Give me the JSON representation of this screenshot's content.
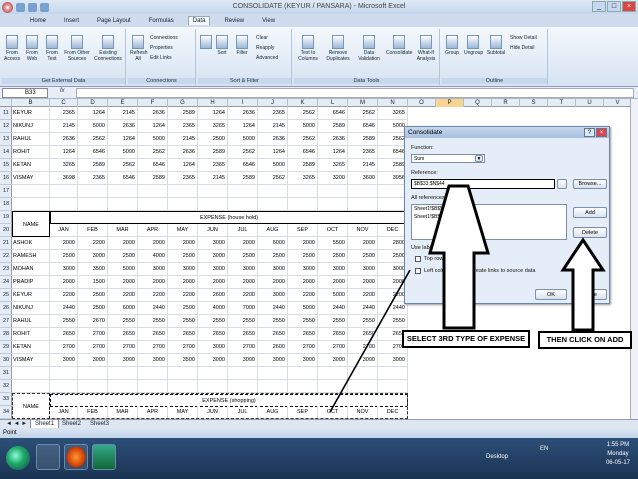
{
  "window": {
    "title": "CONSOLIDATE (KEYUR / PANSARA) - Microsoft Excel"
  },
  "ribbon_tabs": [
    "Home",
    "Insert",
    "Page Layout",
    "Formulas",
    "Data",
    "Review",
    "View"
  ],
  "active_tab": "Data",
  "ribbon": {
    "get_external": {
      "label": "Get External Data",
      "buttons": [
        "From Access",
        "From Web",
        "From Text",
        "From Other Sources",
        "Existing Connections"
      ]
    },
    "connections": {
      "label": "Connections",
      "refresh": "Refresh All",
      "items": [
        "Connections",
        "Properties",
        "Edit Links"
      ]
    },
    "sort_filter": {
      "label": "Sort & Filter",
      "sort": "Sort",
      "filter": "Filter",
      "items": [
        "Clear",
        "Reapply",
        "Advanced"
      ]
    },
    "data_tools": {
      "label": "Data Tools",
      "buttons": [
        "Text to Columns",
        "Remove Duplicates",
        "Data Validation",
        "Consolidate",
        "What-If Analysis"
      ]
    },
    "outline": {
      "label": "Outline",
      "buttons": [
        "Group",
        "Ungroup",
        "Subtotal"
      ],
      "items": [
        "Show Detail",
        "Hide Detail"
      ]
    }
  },
  "formula_bar": {
    "name_box": "B33",
    "fx": "fx",
    "value": ""
  },
  "columns": [
    "B",
    "C",
    "D",
    "E",
    "F",
    "G",
    "H",
    "I",
    "J",
    "K",
    "L",
    "M",
    "N",
    "O",
    "P",
    "Q",
    "R",
    "S",
    "T",
    "U",
    "V"
  ],
  "selected_column": "P",
  "rows_top": [
    {
      "r": "11",
      "name": "KEYUR",
      "v": [
        "2365",
        "1264",
        "2145",
        "2636",
        "2589",
        "1264",
        "2636",
        "2365",
        "2562",
        "6546",
        "2562",
        "3265"
      ]
    },
    {
      "r": "12",
      "name": "NIKUNJ",
      "v": [
        "2145",
        "5000",
        "2636",
        "1264",
        "2365",
        "3265",
        "1264",
        "2145",
        "5000",
        "2589",
        "6546",
        "5000"
      ]
    },
    {
      "r": "13",
      "name": "RAHUL",
      "v": [
        "2636",
        "2562",
        "1264",
        "5000",
        "2145",
        "2500",
        "5000",
        "2636",
        "2562",
        "2636",
        "2589",
        "2562"
      ]
    },
    {
      "r": "14",
      "name": "ROHIT",
      "v": [
        "1264",
        "6546",
        "5000",
        "2562",
        "2636",
        "2589",
        "2562",
        "1264",
        "6546",
        "1264",
        "2365",
        "6546"
      ]
    },
    {
      "r": "15",
      "name": "KETAN",
      "v": [
        "3265",
        "2589",
        "2562",
        "6546",
        "1264",
        "2365",
        "6546",
        "5000",
        "2589",
        "3265",
        "2145",
        "2589"
      ]
    },
    {
      "r": "16",
      "name": "VISMAY",
      "v": [
        "3698",
        "2365",
        "6546",
        "2589",
        "2365",
        "2145",
        "2589",
        "2562",
        "3265",
        "3200",
        "3600",
        "3956"
      ]
    }
  ],
  "block2": {
    "title": "EXPENSE (house hold)",
    "name_header": "NAME",
    "months": [
      "JAN",
      "FEB",
      "MAR",
      "APR",
      "MAY",
      "JUN",
      "JUL",
      "AUG",
      "SEP",
      "OCT",
      "NOV",
      "DEC"
    ],
    "rows": [
      {
        "r": "21",
        "name": "ASHOK",
        "v": [
          "2000",
          "2200",
          "2000",
          "2000",
          "2000",
          "3000",
          "2000",
          "6000",
          "2000",
          "5500",
          "2000",
          "2800"
        ]
      },
      {
        "r": "22",
        "name": "RAMESH",
        "v": [
          "2500",
          "3000",
          "2500",
          "4000",
          "2500",
          "3000",
          "2500",
          "2500",
          "2500",
          "2500",
          "2500",
          "2500"
        ]
      },
      {
        "r": "23",
        "name": "MOHAN",
        "v": [
          "3000",
          "3500",
          "5000",
          "3000",
          "3000",
          "3000",
          "3000",
          "3000",
          "3000",
          "3000",
          "3000",
          "3000"
        ]
      },
      {
        "r": "24",
        "name": "PRADIP",
        "v": [
          "2000",
          "1500",
          "2000",
          "2000",
          "2000",
          "2000",
          "2000",
          "2000",
          "2000",
          "2000",
          "2000",
          "2000"
        ]
      },
      {
        "r": "25",
        "name": "KEYUR",
        "v": [
          "2200",
          "2500",
          "2200",
          "2200",
          "2200",
          "2600",
          "2200",
          "3000",
          "2200",
          "5000",
          "2200",
          "2200"
        ]
      },
      {
        "r": "26",
        "name": "NIKUNJ",
        "v": [
          "2440",
          "2500",
          "6000",
          "2440",
          "2500",
          "4000",
          "7000",
          "2440",
          "5000",
          "2440",
          "2440",
          "2440"
        ]
      },
      {
        "r": "27",
        "name": "RAHUL",
        "v": [
          "2550",
          "2670",
          "2550",
          "2550",
          "2550",
          "2550",
          "2550",
          "2550",
          "2550",
          "2550",
          "2550",
          "2550"
        ]
      },
      {
        "r": "28",
        "name": "ROHIT",
        "v": [
          "2650",
          "2700",
          "2650",
          "2650",
          "2650",
          "2650",
          "2650",
          "2650",
          "2650",
          "2650",
          "2650",
          "2650"
        ]
      },
      {
        "r": "29",
        "name": "KETAN",
        "v": [
          "2700",
          "2700",
          "2700",
          "2700",
          "2700",
          "3000",
          "2700",
          "2600",
          "2700",
          "2700",
          "2700",
          "2700"
        ]
      },
      {
        "r": "30",
        "name": "VISMAY",
        "v": [
          "3000",
          "3000",
          "3000",
          "3000",
          "3500",
          "3000",
          "3000",
          "3000",
          "3000",
          "3000",
          "3000",
          "3000"
        ]
      }
    ]
  },
  "block3": {
    "title": "EXPENSE (shopping)",
    "name_header": "NAME",
    "months": [
      "JAN",
      "FEB",
      "MAR",
      "APR",
      "MAY",
      "JUN",
      "JUL",
      "AUG",
      "SEP",
      "OCT",
      "NOV",
      "DEC"
    ]
  },
  "row_numbers": [
    "11",
    "12",
    "13",
    "14",
    "15",
    "16",
    "17",
    "18",
    "19",
    "20",
    "21",
    "22",
    "23",
    "24",
    "25",
    "26",
    "27",
    "28",
    "29",
    "30",
    "31",
    "32",
    "33",
    "34"
  ],
  "sheet_tabs": [
    "Sheet1",
    "Sheet2",
    "Sheet3"
  ],
  "active_sheet": "Sheet1",
  "status": "Point",
  "dialog": {
    "title": "Consolidate",
    "function_label": "Function:",
    "function_value": "Sum",
    "reference_label": "Reference:",
    "reference_value": "$B$33:$N$44",
    "all_refs_label": "All references:",
    "all_refs": [
      "Sheet1!$B$5:$N$16",
      "Sheet1!$B$19:$N$30"
    ],
    "browse": "Browse...",
    "add": "Add",
    "delete": "Delete",
    "use_labels": "Use labels in",
    "top_row": "Top row",
    "left_column": "Left column",
    "create_links": "Create links to source data",
    "ok": "OK",
    "close": "Close"
  },
  "callouts": {
    "left": "SELECT 3RD TYPE OF EXPENSE",
    "right": "THEN CLICK ON ADD"
  },
  "taskbar": {
    "desktop": "Desktop",
    "lang": "EN",
    "time": "1:55 PM",
    "day": "Monday",
    "date": "06-05-17"
  }
}
